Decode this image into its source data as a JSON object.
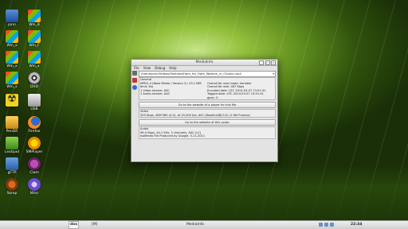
{
  "desktop": {
    "icons": [
      {
        "label": "jonn",
        "icon": "folder-blue-icon"
      },
      {
        "label": "Win_8",
        "icon": "windows-icon"
      },
      {
        "label": "Win_x",
        "icon": "windows-icon"
      },
      {
        "label": "Win_F",
        "icon": "windows-icon"
      },
      {
        "label": "Win_x",
        "icon": "windows-icon"
      },
      {
        "label": "Win_x",
        "icon": "windows-icon"
      },
      {
        "label": "Win_x",
        "icon": "windows-icon"
      },
      {
        "label": "DVD",
        "icon": "dvd-disc-icon"
      },
      {
        "label": "",
        "icon": "radiation-icon"
      },
      {
        "label": "USB",
        "icon": "usb-drive-icon"
      },
      {
        "label": "PenDR",
        "icon": "pendrive-icon"
      },
      {
        "label": "Firefox",
        "icon": "firefox-icon"
      },
      {
        "label": "Leafpad",
        "icon": "leafpad-icon"
      },
      {
        "label": "SMPlayer",
        "icon": "smplayer-icon"
      },
      {
        "label": "gFTP",
        "icon": "ftp-icon"
      },
      {
        "label": "Clam",
        "icon": "clamav-icon"
      },
      {
        "label": "Skmp",
        "icon": "skmp-icon"
      },
      {
        "label": "NVsr",
        "icon": "nvsr-icon"
      }
    ]
  },
  "window": {
    "title": "MediaInfo",
    "menu": [
      "File",
      "View",
      "Debug",
      "Help"
    ],
    "path": "/home/jonn/Videos/Youtube/Ham_for_Ham_Women_in_Chains.mp4",
    "general": {
      "heading": "General",
      "left": [
        "MPEG-4 (Base Media / Version 2): 23.1 MiB",
        "6min 3ss",
        "1 Video stream: AVC",
        "1 Audio stream: AAC"
      ],
      "right": [
        "Overall bit rate mode: Variable",
        "Overall bit rate: 487 Kbps",
        "Encoded date: UTC 2014-03-07 13:51:41",
        "Tagged date: UTC 2014-03-07 13:51:41",
        "gpac: 0"
      ],
      "button": "Go to the website of a player for this file"
    },
    "video": {
      "heading": "Video",
      "line": "359 Kbps, 480*360 (4:3), at 25.000 fps, AVC (Baseline@L3.0) (1 Ref Frames)",
      "button": "Go to the website of this codec"
    },
    "audio": {
      "heading": "Audio",
      "lines": [
        "96.0 Kbps, 44.1 KHz, 2 channels, AAC (LC)",
        "IsoMedia File Produced by Google, 5-11-2011"
      ]
    }
  },
  "taskbar": {
    "start": "dos",
    "workspace": "[M]",
    "task": "MediaInfo",
    "clock": "22:34"
  },
  "colors": {
    "accent": "#7fb52c",
    "window_bg": "#e3e3e3",
    "taskbar_bg": "#dcdcdc"
  }
}
